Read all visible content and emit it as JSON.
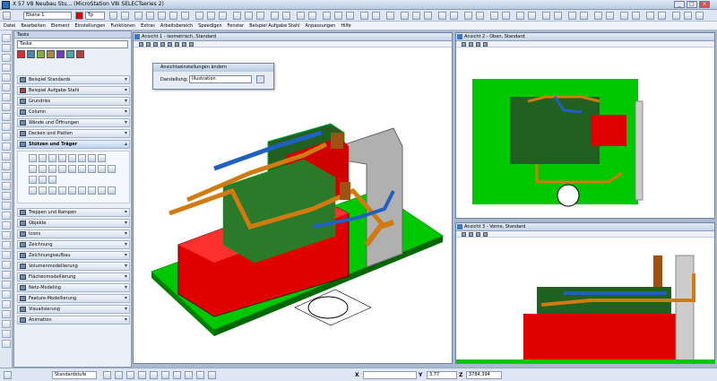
{
  "app": {
    "title": "X 57 V8 Neubau Stu... (MicroStation V8i SELECTseries 2)"
  },
  "colors": {
    "bg": "#a9b9cf",
    "green": "#00c800",
    "red": "#e00000",
    "orange": "#d07a10",
    "blue": "#2060c0",
    "darkgreen": "#206020"
  },
  "toolbar": {
    "level_value": "Ebene 1",
    "zoom_value": "Tp"
  },
  "menu": [
    "Datei",
    "Bearbeiten",
    "Element",
    "Einstellungen",
    "Funktionen",
    "Extras",
    "Arbeitsbereich",
    "Speedlgen",
    "Fenster",
    "Beispiel Aufgabe Stahl",
    "Anpassungen",
    "Hilfe"
  ],
  "tasks": {
    "title": "Tasks",
    "selected": "Taske",
    "categories": [
      "Beispiel Standards",
      "Beispiel Aufgabe Stahl",
      "Grundriss",
      "Column",
      "Wände und Öffnungen",
      "Decken und Platten",
      "Stützen und Träger",
      "Treppen und Rampen",
      "Objekte",
      "Icons",
      "Zeichnung",
      "Zeichnungsaufbau",
      "Volumenmodellierung",
      "Flächenmodellierung",
      "Netz-Modeling",
      "Feature-Modellierung",
      "Visualisierung",
      "Animation"
    ]
  },
  "views": {
    "v1": {
      "title": "Ansicht 1 - Isometrisch, Standard"
    },
    "v2": {
      "title": "Ansicht 2 - Oben, Standard"
    },
    "v3": {
      "title": "Ansicht 3 - Vorne, Standard"
    }
  },
  "dialog": {
    "title": "Ansichtseinstellungen ändern",
    "label": "Darstellung:",
    "value": "Illustration"
  },
  "status": {
    "x_label": "X",
    "y_label": "Y",
    "z_label": "Z",
    "x_value": "",
    "y_value": "3.77",
    "z_value": "3784.394",
    "snap": "Standardstufe"
  }
}
